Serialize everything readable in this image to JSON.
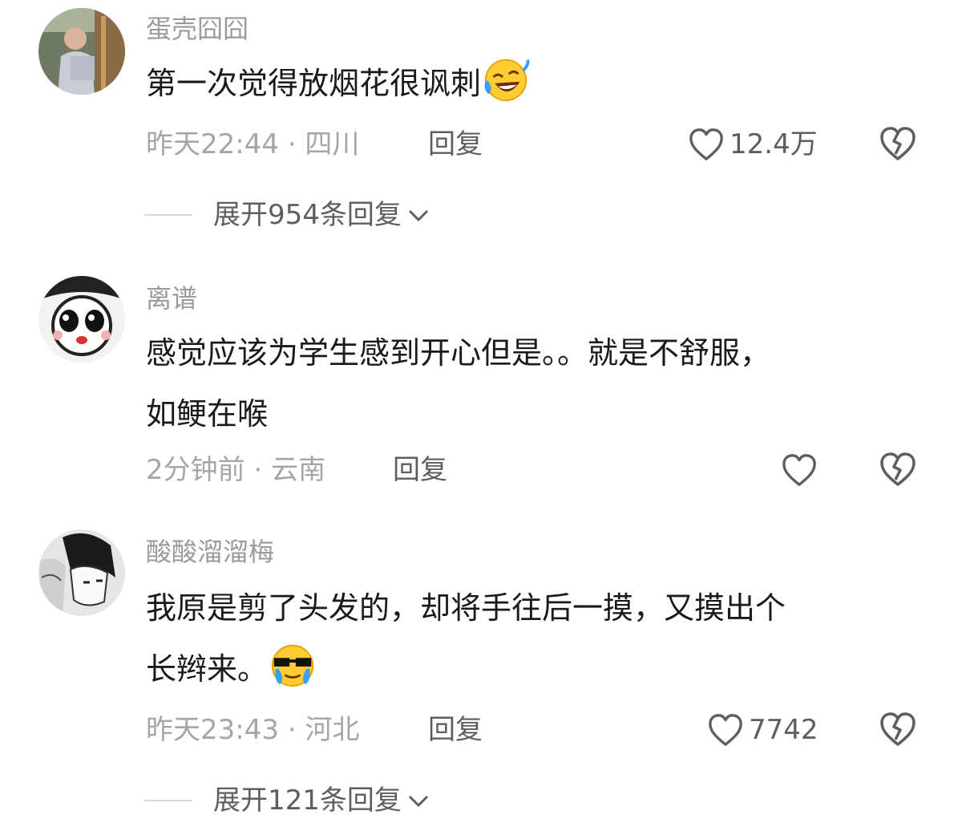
{
  "comments": [
    {
      "username": "蛋壳囧囧",
      "text": "第一次觉得放烟花很讽刺",
      "emoji": "rolling-on-floor-laughing-emoji",
      "time": "昨天22:44",
      "location": "四川",
      "reply_label": "回复",
      "like_count": "12.4万",
      "expand_label": "展开954条回复"
    },
    {
      "username": "离谱",
      "text_line1": "感觉应该为学生感到开心但是。。就是不舒服，",
      "text_line2": "如鲠在喉",
      "time": "2分钟前",
      "location": "云南",
      "reply_label": "回复"
    },
    {
      "username": "酸酸溜溜梅",
      "text_line1": "我原是剪了头发的，却将手往后一摸，又摸出个",
      "text_line2": "长辫来。",
      "emoji": "crying-with-sunglasses-emoji",
      "time": "昨天23:43",
      "location": "河北",
      "reply_label": "回复",
      "like_count": "7742",
      "expand_label": "展开121条回复"
    }
  ],
  "separator": " · ",
  "icons": [
    "heart-outline-icon",
    "broken-heart-icon",
    "chevron-down-icon"
  ],
  "colors": {
    "username": "#9a9a9a",
    "text": "#1a1a1a",
    "meta": "#a6a6a6",
    "action": "#5e5e5e"
  }
}
